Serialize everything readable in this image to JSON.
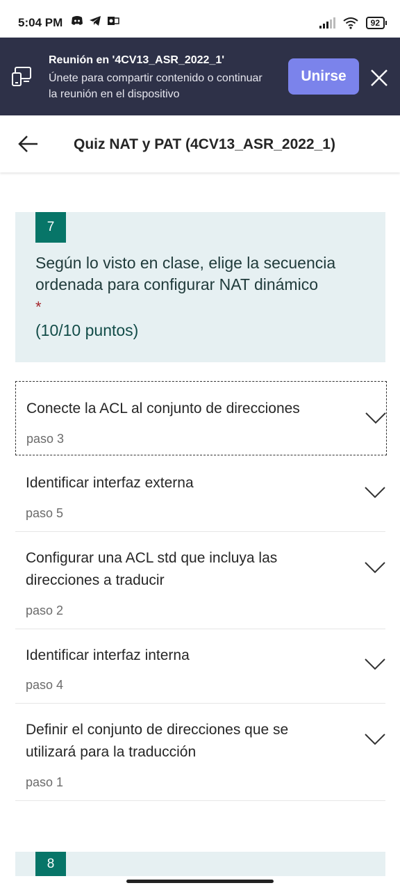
{
  "status": {
    "time": "5:04 PM",
    "battery": "92",
    "left_icons": [
      "discord-icon",
      "telegram-icon",
      "outlook-icon"
    ]
  },
  "banner": {
    "title": "Reunión en '4CV13_ASR_2022_1'",
    "text": "Únete para compartir contenido o continuar la reunión en el dispositivo",
    "join_label": "Unirse",
    "bg_color": "#2e3148",
    "join_color": "#7b83eb"
  },
  "header": {
    "title": "Quiz NAT y PAT (4CV13_ASR_2022_1)"
  },
  "question": {
    "number": "7",
    "text": "Según lo visto en clase, elige la secuencia ordenada  para configurar NAT dinámico",
    "required_mark": "*",
    "points": "(10/10 puntos)"
  },
  "options": [
    {
      "label": "Conecte la ACL al conjunto de direcciones",
      "step": "paso 3"
    },
    {
      "label": "Identificar interfaz externa",
      "step": "paso 5"
    },
    {
      "label": "Configurar una ACL std que incluya las direcciones a traducir",
      "step": "paso 2"
    },
    {
      "label": "Identificar interfaz interna",
      "step": "paso 4"
    },
    {
      "label": "Definir el conjunto de direcciones que se utilizará para la traducción",
      "step": "paso 1"
    }
  ],
  "next_question": {
    "number": "8"
  },
  "colors": {
    "accent": "#077568",
    "card_bg": "#e6f0f2",
    "required": "#a4262c"
  }
}
